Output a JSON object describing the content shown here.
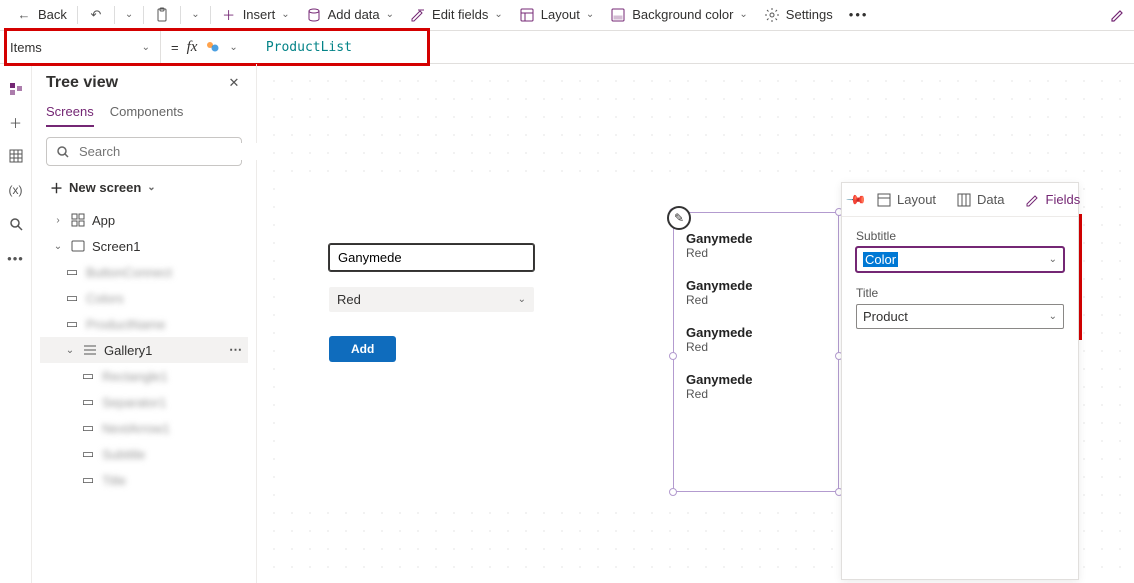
{
  "toolbar": {
    "back": "Back",
    "insert": "Insert",
    "addData": "Add data",
    "editFields": "Edit fields",
    "layout": "Layout",
    "bgColor": "Background color",
    "settings": "Settings"
  },
  "formula": {
    "property": "Items",
    "value": "ProductList"
  },
  "tree": {
    "title": "Tree view",
    "tabs": {
      "screens": "Screens",
      "components": "Components"
    },
    "searchPlaceholder": "Search",
    "newScreen": "New screen",
    "nodes": {
      "app": "App",
      "screen1": "Screen1",
      "n1": "ButtonConnect",
      "n2": "Colors",
      "n3": "ProductName",
      "gallery": "Gallery1",
      "g1": "Rectangle1",
      "g2": "Separator1",
      "g3": "NextArrow1",
      "g4": "Subtitle",
      "g5": "Title"
    }
  },
  "form": {
    "textValue": "Ganymede",
    "ddValue": "Red",
    "addBtn": "Add"
  },
  "gallery": {
    "items": [
      {
        "title": "Ganymede",
        "sub": "Red"
      },
      {
        "title": "Ganymede",
        "sub": "Red"
      },
      {
        "title": "Ganymede",
        "sub": "Red"
      },
      {
        "title": "Ganymede",
        "sub": "Red"
      }
    ]
  },
  "panel": {
    "tabs": {
      "layout": "Layout",
      "data": "Data",
      "fields": "Fields"
    },
    "subtitleLabel": "Subtitle",
    "subtitleValue": "Color",
    "titleLabel": "Title",
    "titleValue": "Product"
  }
}
